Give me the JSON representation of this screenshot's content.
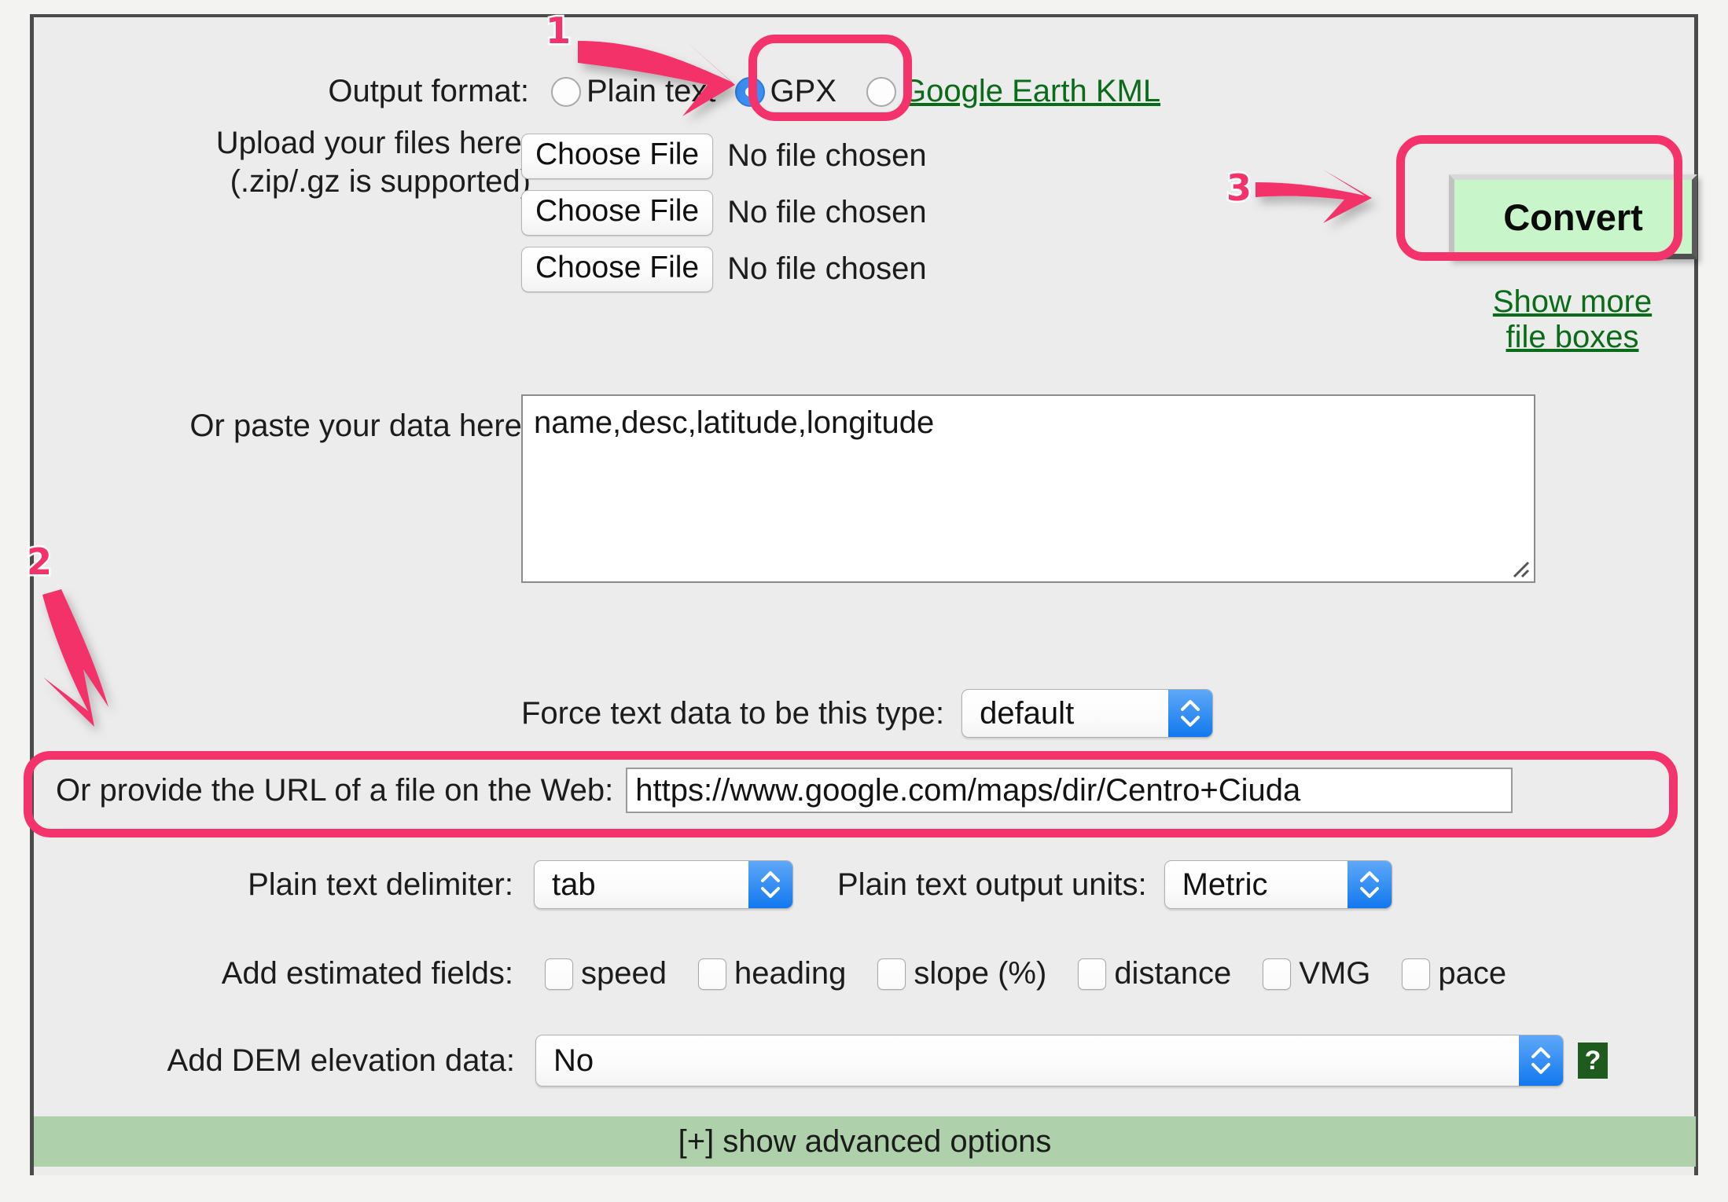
{
  "output_format": {
    "label": "Output format:",
    "options": [
      {
        "label": "Plain text",
        "selected": false,
        "is_link": false
      },
      {
        "label": "GPX",
        "selected": true,
        "is_link": false
      },
      {
        "label": "Google Earth KML",
        "selected": false,
        "is_link": true
      }
    ]
  },
  "upload": {
    "label_line1": "Upload your files here:",
    "label_line2": "(.zip/.gz is supported)",
    "button_label": "Choose File",
    "status": "No file chosen",
    "rows": 3
  },
  "convert": {
    "label": "Convert"
  },
  "show_more": {
    "line1": "Show more",
    "line2": "file boxes"
  },
  "paste": {
    "label": "Or paste your data here:",
    "value": "name,desc,latitude,longitude",
    "placeholder": ""
  },
  "force_type": {
    "label": "Force text data to be this type:",
    "value": "default"
  },
  "url": {
    "label": "Or provide the URL of a file on the Web:",
    "value": "https://www.google.com/maps/dir/Centro+Ciuda",
    "placeholder": ""
  },
  "delimiter": {
    "label": "Plain text delimiter:",
    "value": "tab"
  },
  "units": {
    "label": "Plain text output units:",
    "value": "Metric"
  },
  "estimated_fields": {
    "label": "Add estimated fields:",
    "items": [
      {
        "label": "speed",
        "checked": false
      },
      {
        "label": "heading",
        "checked": false
      },
      {
        "label": "slope (%)",
        "checked": false
      },
      {
        "label": "distance",
        "checked": false
      },
      {
        "label": "VMG",
        "checked": false
      },
      {
        "label": "pace",
        "checked": false
      }
    ]
  },
  "dem": {
    "label": "Add DEM elevation data:",
    "value": "No",
    "help_glyph": "?"
  },
  "advanced": {
    "label": "[+] show advanced options"
  },
  "annotations": [
    {
      "number": "1"
    },
    {
      "number": "2"
    },
    {
      "number": "3"
    }
  ],
  "colors": {
    "annotation": "#f4326b",
    "link_green": "#0a6b18",
    "convert_bg": "#c9f5ca",
    "advanced_bar_bg": "#aed1ab",
    "panel_bg": "#ececec",
    "radio_selected": "#3b8ef2",
    "stepper_blue": "#1278ef",
    "help_icon_bg": "#1f5a1f"
  }
}
